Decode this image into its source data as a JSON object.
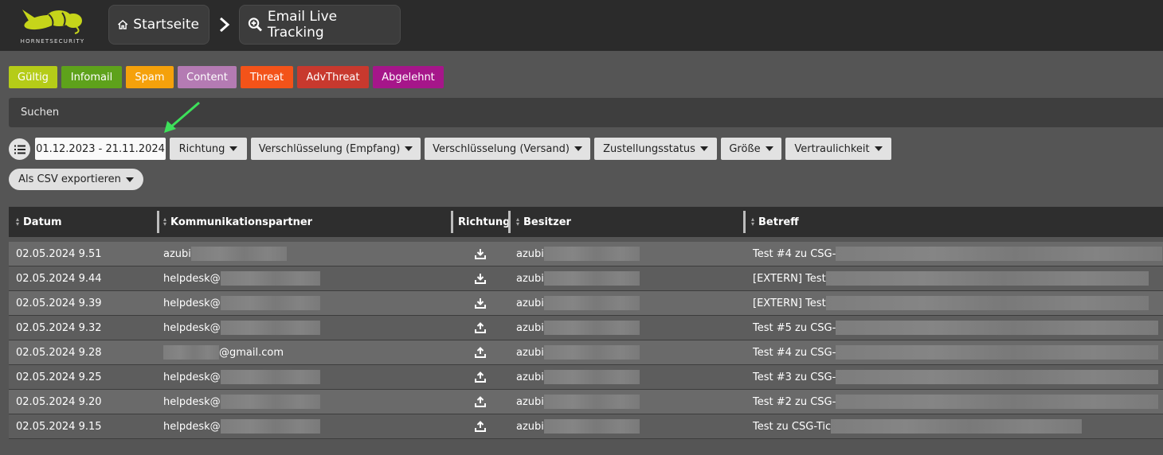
{
  "header": {
    "logo_text": "HORNETSECURITY",
    "breadcrumb": [
      {
        "label": "Startseite",
        "icon": "home-icon"
      },
      {
        "label": "Email Live Tracking",
        "icon": "zoom-in-icon"
      }
    ]
  },
  "status_filters": [
    {
      "label": "Gültig",
      "color": "#b5cc18"
    },
    {
      "label": "Infomail",
      "color": "#5ea21b"
    },
    {
      "label": "Spam",
      "color": "#f5a10b"
    },
    {
      "label": "Content",
      "color": "#b47bb3"
    },
    {
      "label": "Threat",
      "color": "#f35319"
    },
    {
      "label": "AdvThreat",
      "color": "#c8392e"
    },
    {
      "label": "Abgelehnt",
      "color": "#a6168a"
    }
  ],
  "search": {
    "placeholder": "Suchen"
  },
  "filters": {
    "date_range": "01.12.2023 - 21.11.2024",
    "dropdowns": [
      "Richtung",
      "Verschlüsselung (Empfang)",
      "Verschlüsselung (Versand)",
      "Zustellungsstatus",
      "Größe",
      "Vertraulichkeit"
    ],
    "export_label": "Als CSV exportieren"
  },
  "table": {
    "columns": [
      "Datum",
      "Kommunikationspartner",
      "Richtung",
      "Besitzer",
      "Betreff"
    ],
    "rows": [
      {
        "date": "02.05.2024 9.51",
        "partner": "azubi",
        "partner_suffix": "",
        "direction": "incoming",
        "owner": "azubi",
        "subject": "Test #4 zu CSG-"
      },
      {
        "date": "02.05.2024 9.44",
        "partner": "helpdesk@",
        "partner_suffix": "",
        "direction": "incoming",
        "owner": "azubi",
        "subject": "[EXTERN] Test"
      },
      {
        "date": "02.05.2024 9.39",
        "partner": "helpdesk@",
        "partner_suffix": "",
        "direction": "incoming",
        "owner": "azubi",
        "subject": "[EXTERN] Test"
      },
      {
        "date": "02.05.2024 9.32",
        "partner": "helpdesk@",
        "partner_suffix": "",
        "direction": "outgoing",
        "owner": "azubi",
        "subject": "Test #5 zu CSG-"
      },
      {
        "date": "02.05.2024 9.28",
        "partner": "",
        "partner_suffix": "@gmail.com",
        "direction": "outgoing",
        "owner": "azubi",
        "subject": "Test #4 zu CSG-"
      },
      {
        "date": "02.05.2024 9.25",
        "partner": "helpdesk@",
        "partner_suffix": "",
        "direction": "outgoing",
        "owner": "azubi",
        "subject": "Test #3 zu CSG-"
      },
      {
        "date": "02.05.2024 9.20",
        "partner": "helpdesk@",
        "partner_suffix": "",
        "direction": "outgoing",
        "owner": "azubi",
        "subject": "Test #2 zu CSG-"
      },
      {
        "date": "02.05.2024 9.15",
        "partner": "helpdesk@",
        "partner_suffix": "",
        "direction": "outgoing",
        "owner": "azubi",
        "subject": "Test zu CSG-Tic"
      }
    ]
  }
}
